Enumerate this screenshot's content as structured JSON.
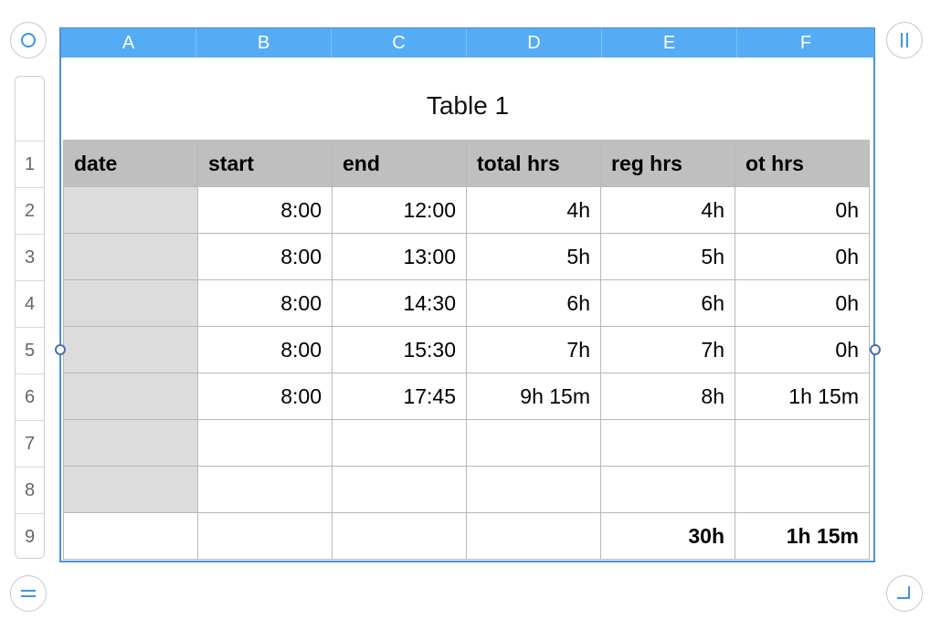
{
  "table_title": "Table 1",
  "columns": [
    "A",
    "B",
    "C",
    "D",
    "E",
    "F"
  ],
  "rows": [
    "1",
    "2",
    "3",
    "4",
    "5",
    "6",
    "7",
    "8",
    "9"
  ],
  "grid": [
    [
      "date",
      "start",
      "end",
      "total hrs",
      "reg hrs",
      "ot hrs"
    ],
    [
      "",
      "8:00",
      "12:00",
      "4h",
      "4h",
      "0h"
    ],
    [
      "",
      "8:00",
      "13:00",
      "5h",
      "5h",
      "0h"
    ],
    [
      "",
      "8:00",
      "14:30",
      "6h",
      "6h",
      "0h"
    ],
    [
      "",
      "8:00",
      "15:30",
      "7h",
      "7h",
      "0h"
    ],
    [
      "",
      "8:00",
      "17:45",
      "9h 15m",
      "8h",
      "1h 15m"
    ],
    [
      "",
      "",
      "",
      "",
      "",
      ""
    ],
    [
      "",
      "",
      "",
      "",
      "",
      ""
    ],
    [
      "",
      "",
      "",
      "",
      "30h",
      "1h 15m"
    ]
  ],
  "colors": {
    "column_header_bg": "#55acf4",
    "header_row_bg": "#bfbfbf",
    "date_column_bg": "#dcdcdc",
    "accent": "#3a94ee"
  },
  "icons": {
    "top_left": "circle-icon",
    "top_right": "pause-icon",
    "bottom_left": "equals-icon",
    "bottom_right": "resize-corner-icon"
  }
}
